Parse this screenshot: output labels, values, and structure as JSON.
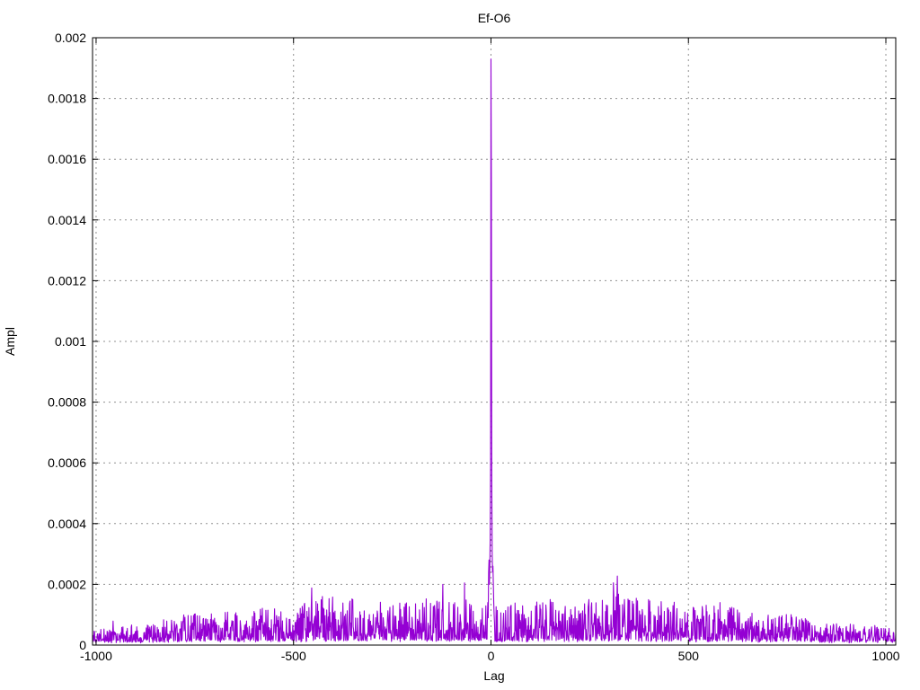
{
  "figure": {
    "background": "#ffffff",
    "border_color": "#000000",
    "grid_color": "#909090",
    "text_color": "#000000"
  },
  "chart_data": {
    "type": "line",
    "title": "Ef-O6",
    "xlabel": "Lag",
    "ylabel": "Ampl",
    "xlim": [
      -1009,
      1025
    ],
    "ylim": [
      0,
      0.002
    ],
    "xticks": [
      {
        "v": -1000,
        "label": "-1000"
      },
      {
        "v": -500,
        "label": "-500"
      },
      {
        "v": 0,
        "label": "0"
      },
      {
        "v": 500,
        "label": "500"
      },
      {
        "v": 1000,
        "label": "1000"
      }
    ],
    "yticks": [
      {
        "v": 0.0,
        "label": "0"
      },
      {
        "v": 0.0002,
        "label": "0.0002"
      },
      {
        "v": 0.0004,
        "label": "0.0004"
      },
      {
        "v": 0.0006,
        "label": "0.0006"
      },
      {
        "v": 0.0008,
        "label": "0.0008"
      },
      {
        "v": 0.001,
        "label": "0.001"
      },
      {
        "v": 0.0012,
        "label": "0.0012"
      },
      {
        "v": 0.0014,
        "label": "0.0014"
      },
      {
        "v": 0.0016,
        "label": "0.0016"
      },
      {
        "v": 0.0018,
        "label": "0.0018"
      },
      {
        "v": 0.002,
        "label": "0.002"
      }
    ],
    "grid": true,
    "grid_style": "dotted",
    "legend": "none",
    "line_color": "#9400d3",
    "peak_points": [
      [
        -9,
        0.0001
      ],
      [
        -8,
        0.00014
      ],
      [
        -7,
        9e-05
      ],
      [
        -6,
        0.00024
      ],
      [
        -5,
        0.00028
      ],
      [
        -4,
        0.0002
      ],
      [
        -3,
        0.00026
      ],
      [
        -2,
        0.00035
      ],
      [
        -1,
        0.0006
      ],
      [
        0,
        0.00193
      ],
      [
        1,
        0.00152
      ],
      [
        2,
        0.00055
      ],
      [
        3,
        0.0003
      ],
      [
        4,
        0.00024
      ],
      [
        5,
        0.00026
      ],
      [
        6,
        0.0002
      ],
      [
        7,
        0.00014
      ],
      [
        8,
        0.0001
      ]
    ],
    "notable_spikes": [
      [
        -427,
        0.00016
      ],
      [
        -350,
        0.00015
      ],
      [
        -122,
        0.0002
      ],
      [
        248,
        0.00015
      ],
      [
        310,
        0.000205
      ],
      [
        580,
        0.00014
      ],
      [
        760,
        0.0001
      ]
    ],
    "noise_envelope": [
      [
        -1009,
        4e-05
      ],
      [
        -900,
        6e-05
      ],
      [
        -800,
        9e-05
      ],
      [
        -700,
        0.0001
      ],
      [
        -600,
        0.00011
      ],
      [
        -500,
        0.00012
      ],
      [
        -420,
        0.00015
      ],
      [
        -350,
        0.00014
      ],
      [
        -250,
        0.00013
      ],
      [
        -150,
        0.00015
      ],
      [
        -60,
        0.00014
      ],
      [
        -15,
        0.00013
      ],
      [
        15,
        0.00012
      ],
      [
        60,
        0.00013
      ],
      [
        150,
        0.00014
      ],
      [
        250,
        0.00014
      ],
      [
        310,
        0.00016
      ],
      [
        400,
        0.00014
      ],
      [
        500,
        0.00013
      ],
      [
        600,
        0.00012
      ],
      [
        700,
        0.0001
      ],
      [
        800,
        8e-05
      ],
      [
        900,
        6e-05
      ],
      [
        1025,
        5e-05
      ]
    ],
    "noise_seed": 20240613,
    "sample_step": 1
  }
}
